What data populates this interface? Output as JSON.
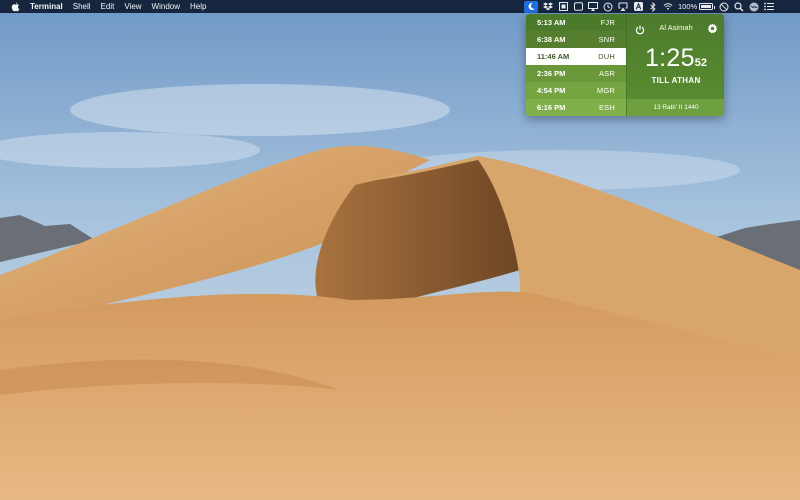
{
  "menubar": {
    "apple_icon": "apple-icon",
    "items": [
      "Terminal",
      "Shell",
      "Edit",
      "View",
      "Window",
      "Help"
    ],
    "status": {
      "battery_text": "100%",
      "icons": [
        "moon-icon",
        "dropbox-icon",
        "calendar-icon",
        "rectangle-icon",
        "airplay-icon",
        "time-machine-icon",
        "airplay-display-icon",
        "input-a-icon",
        "bluetooth-icon",
        "wifi-icon",
        "battery-icon",
        "do-not-disturb-icon",
        "spotlight-icon",
        "siri-icon",
        "notification-center-icon"
      ]
    }
  },
  "popover": {
    "times": [
      {
        "time": "5:13 AM",
        "name": "FJR"
      },
      {
        "time": "6:38 AM",
        "name": "SNR"
      },
      {
        "time": "11:46 AM",
        "name": "DUH"
      },
      {
        "time": "2:36 PM",
        "name": "ASR"
      },
      {
        "time": "4:54 PM",
        "name": "MGR"
      },
      {
        "time": "6:16 PM",
        "name": "ESH"
      }
    ],
    "active_index": 2,
    "location": "Al Asimah",
    "countdown": {
      "hm": "1:25",
      "sec": "52"
    },
    "till_label": "TILL ATHAN",
    "hijri_date": "13 Rabi' II 1440",
    "row_colors": [
      "#4c7a2b",
      "#557f2f",
      "#ffffff",
      "#6a9838",
      "#75a540",
      "#80b04a"
    ]
  }
}
